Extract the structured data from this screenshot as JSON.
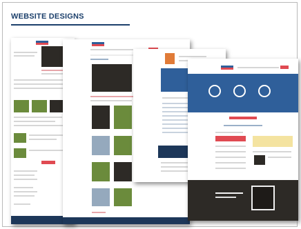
{
  "slide": {
    "title": "WEBSITE DESIGNS"
  },
  "colors": {
    "title": "#1b3f6b",
    "accent_red": "#e04a52",
    "navy": "#1d3759",
    "hero_blue": "#2f5f9a"
  }
}
